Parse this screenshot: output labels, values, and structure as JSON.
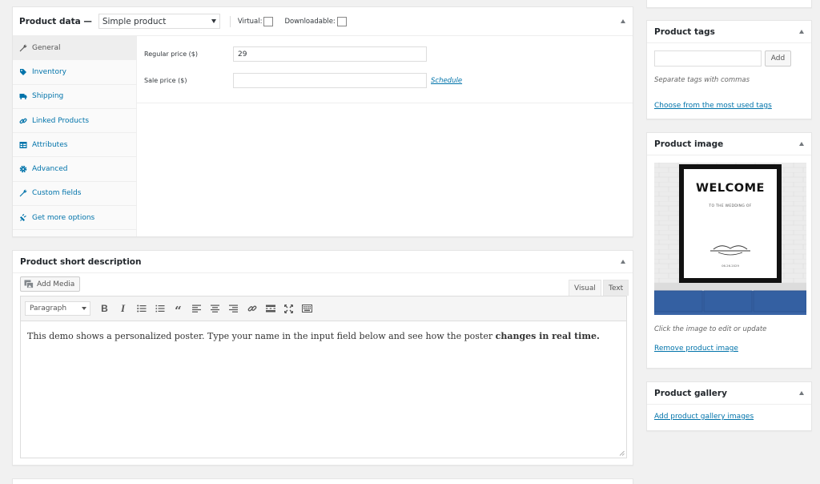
{
  "product_data": {
    "title": "Product data —",
    "type_select": "Simple product",
    "virtual_label": "Virtual:",
    "downloadable_label": "Downloadable:",
    "tabs": [
      {
        "label": "General",
        "icon": "wrench-icon"
      },
      {
        "label": "Inventory",
        "icon": "tag-icon"
      },
      {
        "label": "Shipping",
        "icon": "truck-icon"
      },
      {
        "label": "Linked Products",
        "icon": "link-icon"
      },
      {
        "label": "Attributes",
        "icon": "table-icon"
      },
      {
        "label": "Advanced",
        "icon": "gear-icon"
      },
      {
        "label": "Custom fields",
        "icon": "wrench-icon"
      },
      {
        "label": "Get more options",
        "icon": "plugin-icon"
      }
    ],
    "regular_price_label": "Regular price ($)",
    "regular_price_value": "29",
    "sale_price_label": "Sale price ($)",
    "sale_price_value": "",
    "schedule_link": "Schedule"
  },
  "short_description": {
    "title": "Product short description",
    "add_media": "Add Media",
    "tab_visual": "Visual",
    "tab_text": "Text",
    "format_select": "Paragraph",
    "content_plain": "This demo shows a personalized poster. Type your name in the input field below and see how the poster ",
    "content_bold": "changes in real time."
  },
  "product_tags": {
    "title": "Product tags",
    "add_button": "Add",
    "hint": "Separate tags with commas",
    "most_used_link": "Choose from the most used tags"
  },
  "product_image": {
    "title": "Product image",
    "poster_heading": "WELCOME",
    "poster_sub": "TO THE WEDDING OF",
    "poster_date": "06.26.2029",
    "hint": "Click the image to edit or update",
    "remove_link": "Remove product image"
  },
  "product_gallery": {
    "title": "Product gallery",
    "add_link": "Add product gallery images"
  },
  "colors": {
    "link": "#0073aa",
    "background": "#f1f1f1",
    "panel_border": "#e5e5e5",
    "sofa": "#3a64a6"
  }
}
